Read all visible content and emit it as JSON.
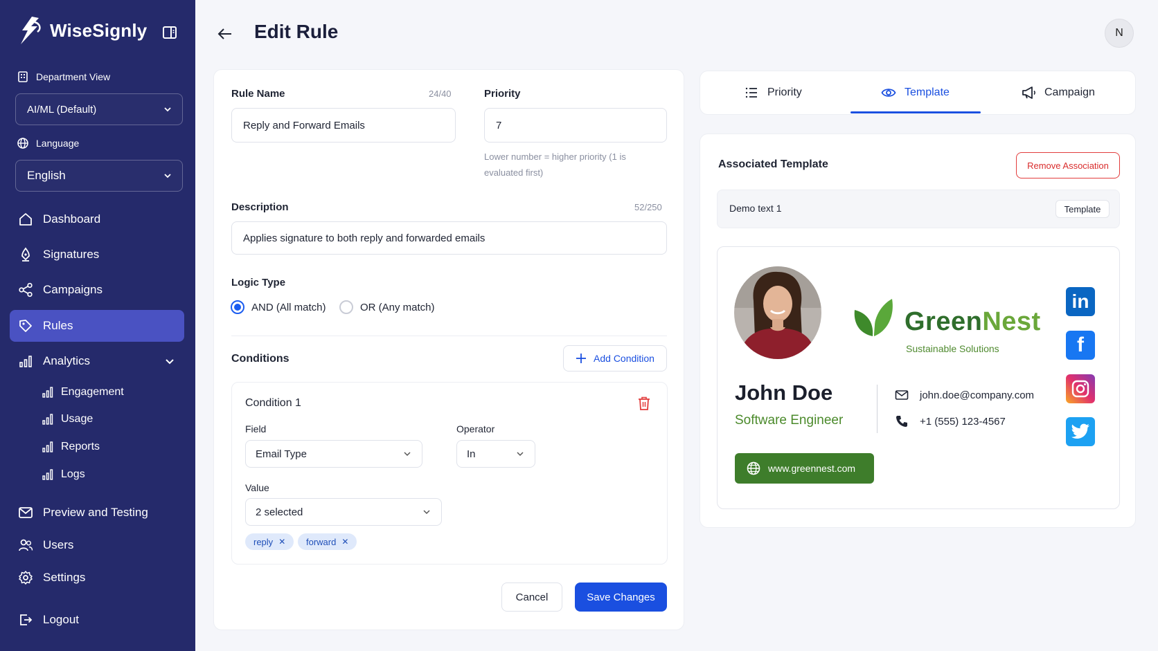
{
  "app": {
    "name": "WiseSignly"
  },
  "sidebar": {
    "department_label": "Department View",
    "department_value": "AI/ML (Default)",
    "language_label": "Language",
    "language_value": "English",
    "nav": [
      {
        "label": "Dashboard",
        "icon": "home-icon"
      },
      {
        "label": "Signatures",
        "icon": "pen-icon"
      },
      {
        "label": "Campaigns",
        "icon": "share-icon"
      },
      {
        "label": "Rules",
        "icon": "tag-icon",
        "active": true
      },
      {
        "label": "Analytics",
        "icon": "bar-chart-icon"
      }
    ],
    "analytics_sub": [
      {
        "label": "Engagement"
      },
      {
        "label": "Usage"
      },
      {
        "label": "Reports"
      },
      {
        "label": "Logs"
      }
    ],
    "nav_bottom": [
      {
        "label": "Preview and Testing",
        "icon": "mail-icon"
      },
      {
        "label": "Users",
        "icon": "users-icon"
      },
      {
        "label": "Settings",
        "icon": "gear-icon"
      }
    ],
    "logout": "Logout"
  },
  "header": {
    "title": "Edit Rule",
    "avatar_initial": "N"
  },
  "form": {
    "rule_name": {
      "label": "Rule Name",
      "counter": "24/40",
      "value": "Reply and Forward Emails"
    },
    "priority": {
      "label": "Priority",
      "value": "7",
      "hint": "Lower number = higher priority (1 is evaluated first)"
    },
    "description": {
      "label": "Description",
      "counter": "52/250",
      "value": "Applies signature to both reply and forwarded emails"
    },
    "logic_type": {
      "label": "Logic Type",
      "options": [
        "AND (All match)",
        "OR (Any match)"
      ],
      "selected": "AND (All match)"
    },
    "conditions": {
      "label": "Conditions",
      "add_label": "Add Condition",
      "items": [
        {
          "title": "Condition 1",
          "field_label": "Field",
          "field_value": "Email Type",
          "operator_label": "Operator",
          "operator_value": "In",
          "value_label": "Value",
          "value_summary": "2 selected",
          "chips": [
            "reply",
            "forward"
          ]
        }
      ]
    },
    "cancel_label": "Cancel",
    "save_label": "Save Changes"
  },
  "right_panel": {
    "tabs": [
      {
        "label": "Priority",
        "icon": "list-icon"
      },
      {
        "label": "Template",
        "icon": "eye-icon",
        "active": true
      },
      {
        "label": "Campaign",
        "icon": "megaphone-icon"
      }
    ],
    "associated_title": "Associated Template",
    "remove_label": "Remove Association",
    "template_name": "Demo text 1",
    "template_badge": "Template",
    "signature": {
      "company_part1": "Green",
      "company_part2": "Nest",
      "tagline": "Sustainable Solutions",
      "name": "John Doe",
      "role": "Software Engineer",
      "email": "john.doe@company.com",
      "phone": "+1 (555) 123-4567",
      "website": "www.greennest.com",
      "socials": [
        "linkedin-icon",
        "facebook-icon",
        "instagram-icon",
        "twitter-icon"
      ]
    }
  },
  "colors": {
    "sidebar_bg": "#252a6b",
    "sidebar_active": "#4a52c2",
    "primary": "#1a4fe0",
    "danger": "#d92c2c",
    "brand_green": "#3e7d2b"
  }
}
